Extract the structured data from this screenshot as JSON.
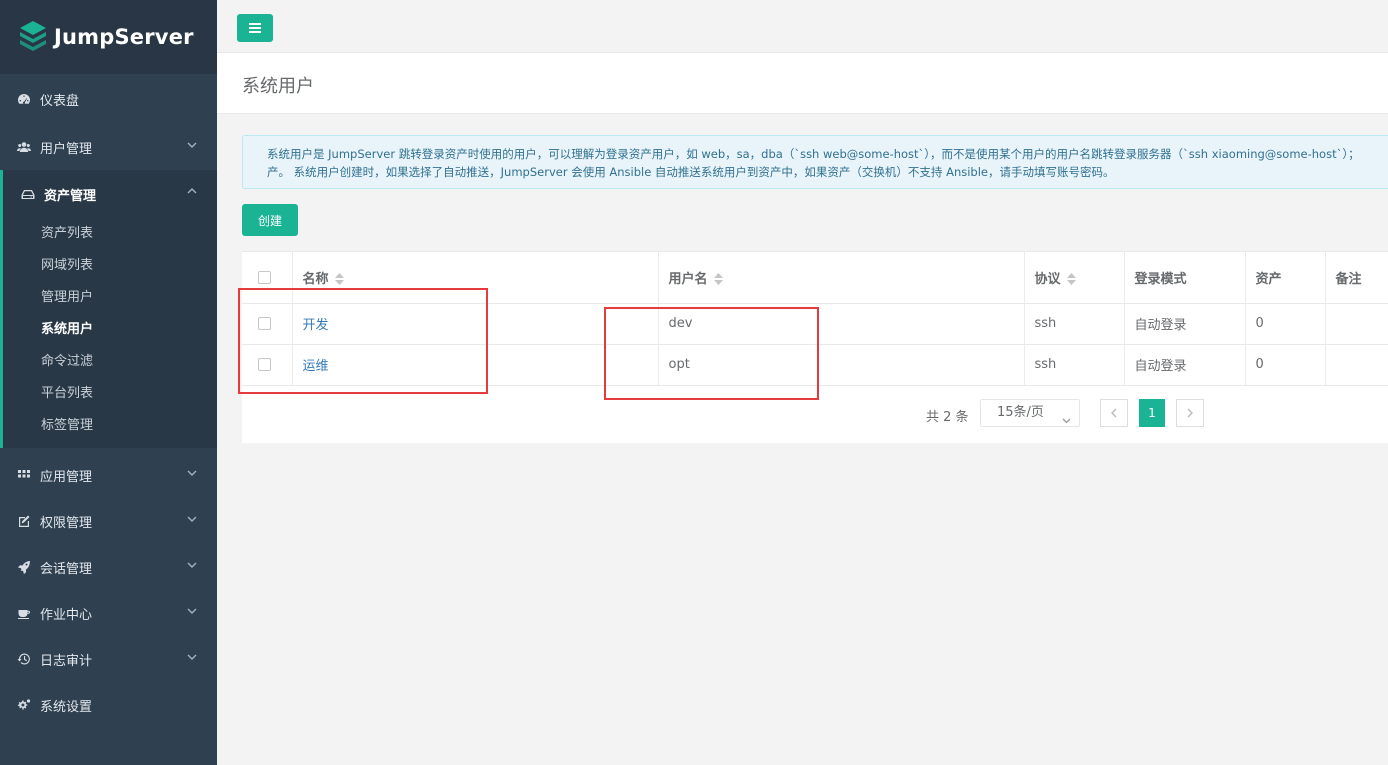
{
  "app": {
    "title": "JumpServer"
  },
  "sidebar": {
    "items": [
      {
        "label": "仪表盘",
        "icon": "dashboard-icon"
      },
      {
        "label": "用户管理",
        "icon": "users-icon"
      },
      {
        "label": "资产管理",
        "icon": "hdd-icon",
        "expanded": true,
        "children": [
          "资产列表",
          "网域列表",
          "管理用户",
          "系统用户",
          "命令过滤",
          "平台列表",
          "标签管理"
        ],
        "active_child": "系统用户"
      },
      {
        "label": "应用管理",
        "icon": "grid-icon"
      },
      {
        "label": "权限管理",
        "icon": "edit-icon"
      },
      {
        "label": "会话管理",
        "icon": "rocket-icon"
      },
      {
        "label": "作业中心",
        "icon": "coffee-icon"
      },
      {
        "label": "日志审计",
        "icon": "history-icon"
      },
      {
        "label": "系统设置",
        "icon": "cogs-icon"
      }
    ]
  },
  "header": {
    "page_title": "系统用户"
  },
  "info": {
    "line1": "系统用户是 JumpServer 跳转登录资产时使用的用户，可以理解为登录资产用户，如 web，sa，dba（`ssh web@some-host`），而不是使用某个用户的用户名跳转登录服务器（`ssh xiaoming@some-host`）；",
    "line2": "产。 系统用户创建时，如果选择了自动推送，JumpServer 会使用 Ansible 自动推送系统用户到资产中，如果资产（交换机）不支持 Ansible，请手动填写账号密码。"
  },
  "toolbar": {
    "create_label": "创建"
  },
  "table": {
    "columns": [
      "名称",
      "用户名",
      "协议",
      "登录模式",
      "资产",
      "备注"
    ],
    "rows": [
      {
        "name": "开发",
        "username": "dev",
        "protocol": "ssh",
        "login_mode": "自动登录",
        "assets": "0",
        "comment": ""
      },
      {
        "name": "运维",
        "username": "opt",
        "protocol": "ssh",
        "login_mode": "自动登录",
        "assets": "0",
        "comment": ""
      }
    ]
  },
  "pagination": {
    "total": "共 2 条",
    "page_size": "15条/页",
    "current_page": "1"
  },
  "colors": {
    "accent": "#1ab394",
    "sidebar_bg": "#2f4050",
    "link": "#337ab7",
    "annotation": "#e53b3b"
  }
}
